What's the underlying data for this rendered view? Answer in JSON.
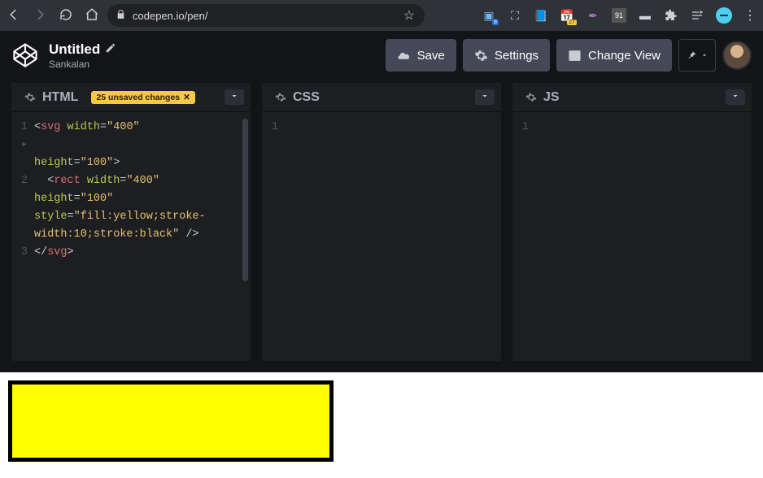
{
  "browser": {
    "url": "codepen.io/pen/",
    "calendar_badge": "27"
  },
  "pen": {
    "title": "Untitled",
    "author": "Sankalan"
  },
  "header": {
    "save": "Save",
    "settings": "Settings",
    "change_view": "Change View"
  },
  "panels": {
    "html": {
      "label": "HTML",
      "unsaved": "25 unsaved changes",
      "ln1": "1",
      "ln2": "2",
      "ln3": "3"
    },
    "css": {
      "label": "CSS",
      "ln1": "1"
    },
    "js": {
      "label": "JS",
      "ln1": "1"
    }
  },
  "code": {
    "svg_open_1": "<svg",
    "width_attr": " width",
    "eq_quote": "=",
    "val_400": "\"400\"",
    "height_attr": "height",
    "val_100": "\"100\"",
    "gt": ">",
    "rect_open": "  <rect",
    "style_attr": "style",
    "style_val": "\"fill:yellow;stroke-width:10;stroke:black\"",
    "self_close": " />",
    "svg_close": "</svg>"
  },
  "output_svg": {
    "w": "400",
    "h": "100",
    "fill": "yellow",
    "stroke": "black",
    "sw": "10"
  }
}
